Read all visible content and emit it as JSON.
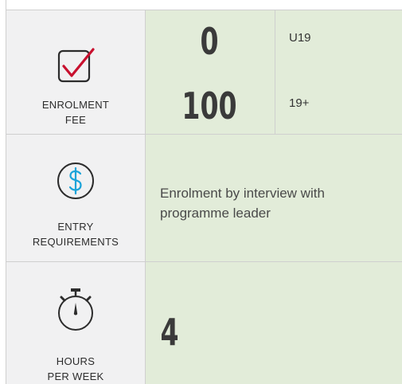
{
  "fee": {
    "label_line1": "ENROLMENT",
    "label_line2": "FEE",
    "icon": "checkbox-check-icon",
    "amounts": [
      {
        "value": "0",
        "group": "U19"
      },
      {
        "value": "100",
        "group": "19+"
      }
    ]
  },
  "entry": {
    "label_line1": "ENTRY",
    "label_line2": "REQUIREMENTS",
    "icon": "dollar-circle-icon",
    "description": "Enrolment by interview with programme leader"
  },
  "hours": {
    "label_line1": "HOURS",
    "label_line2": "PER WEEK",
    "icon": "stopwatch-icon",
    "value": "4"
  },
  "colors": {
    "check_red": "#c8102e",
    "dollar_blue": "#1aa3d9",
    "value_bg": "#e2ecd9",
    "label_bg": "#f1f1f2"
  }
}
